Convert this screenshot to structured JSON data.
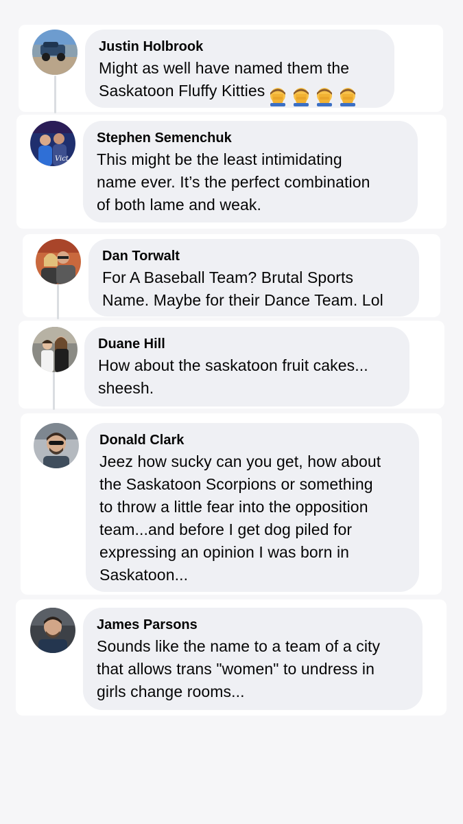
{
  "comments": [
    {
      "author": "Justin Holbrook",
      "text": "Might as well have named them the\nSaskatoon Fluffy Kitties",
      "emoji": [
        "face-palm-icon",
        "face-palm-icon",
        "face-palm-icon",
        "face-palm-icon"
      ]
    },
    {
      "author": "Stephen Semenchuk",
      "text": "This might be the least intimidating\nname ever. It’s the perfect combination\nof both lame and weak."
    },
    {
      "author": "Dan Torwalt",
      "text": "For A Baseball Team? Brutal Sports\nName.  Maybe for their Dance Team. Lol"
    },
    {
      "author": "Duane Hill",
      "text": "How about the saskatoon fruit cakes...\nsheesh."
    },
    {
      "author": "Donald Clark",
      "text": "Jeez how sucky can you get, how about\nthe Saskatoon Scorpions or something\nto throw a little fear into the opposition\nteam...and before I get dog piled for\nexpressing an opinion I was born in\nSaskatoon..."
    },
    {
      "author": "James Parsons",
      "text": "Sounds like the name to a team of a city\nthat allows trans \"women\" to undress in\ngirls change rooms..."
    }
  ],
  "colors": {
    "page_background": "#f6f6f8",
    "card_background": "#ffffff",
    "bubble_background": "#eff0f4",
    "text": "#050505",
    "thread_line": "#dadde1"
  }
}
